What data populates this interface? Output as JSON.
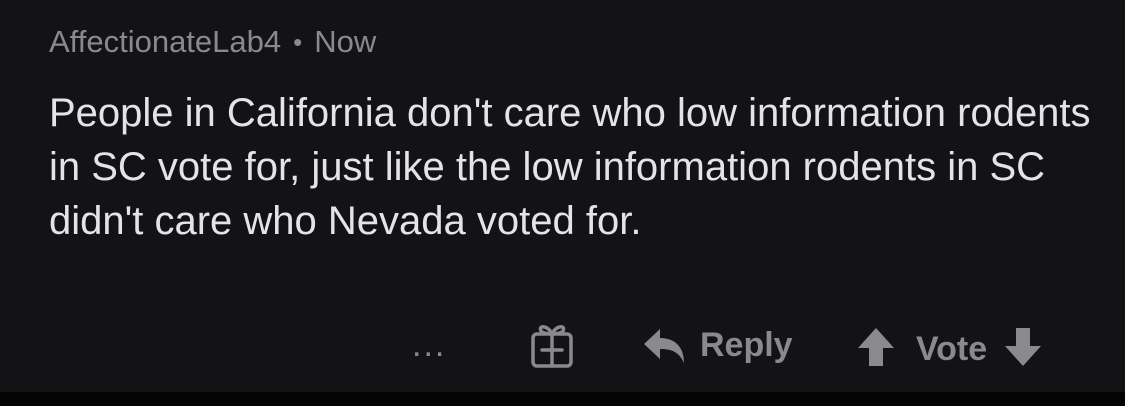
{
  "comment": {
    "author": "AffectionateLab4",
    "separator": "•",
    "timestamp": "Now",
    "body": "People in California don't care who low information rodents in SC vote for, just like the low information rodents in SC didn't care who Nevada voted for."
  },
  "actions": {
    "more_label": "...",
    "award_icon": "gift-icon",
    "reply_icon": "reply-arrow-icon",
    "reply_label": "Reply",
    "upvote_icon": "arrow-up-icon",
    "vote_label": "Vote",
    "downvote_icon": "arrow-down-icon"
  },
  "colors": {
    "background": "#131315",
    "text_primary": "#e4e4e6",
    "text_secondary": "#8a8a8e"
  }
}
